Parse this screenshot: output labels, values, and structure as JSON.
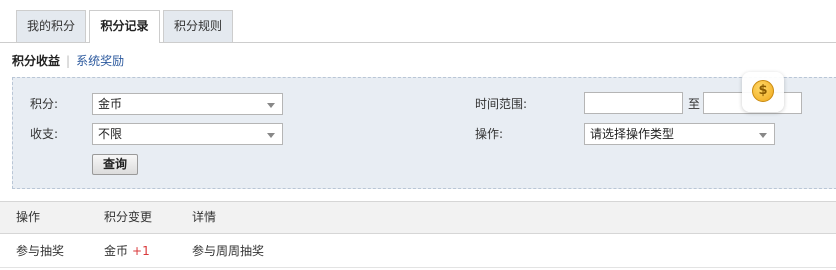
{
  "tabs": [
    {
      "label": "我的积分",
      "active": false
    },
    {
      "label": "积分记录",
      "active": true
    },
    {
      "label": "积分规则",
      "active": false
    }
  ],
  "subnav": {
    "current": "积分收益",
    "separator": "|",
    "link": "系统奖励"
  },
  "filter": {
    "points_label": "积分:",
    "points_value": "金币",
    "direction_label": "收支:",
    "direction_value": "不限",
    "time_label": "时间范围:",
    "time_to": "至",
    "time_start": "",
    "time_end": "",
    "action_label": "操作:",
    "action_value": "请选择操作类型",
    "query_button": "查询"
  },
  "table": {
    "headers": [
      "操作",
      "积分变更",
      "详情"
    ],
    "rows": [
      {
        "action": "参与抽奖",
        "currency": "金币",
        "change": "+1",
        "detail": "参与周周抽奖"
      }
    ]
  },
  "colors": {
    "accent_link": "#2d5a9e",
    "positive_change": "#d9383a",
    "panel_bg": "#e8edf3"
  },
  "icons": {
    "coin": "coin-icon"
  }
}
